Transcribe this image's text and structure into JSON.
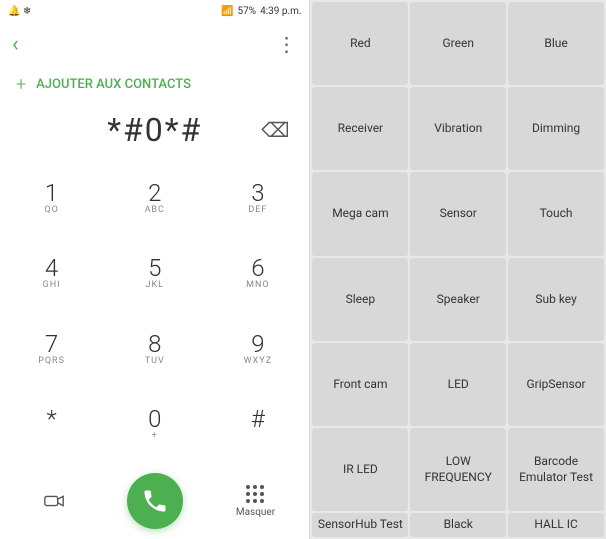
{
  "statusBar": {
    "left": "🔔 ❄",
    "signal": "📶",
    "battery": "57%",
    "time": "4:39 p.m."
  },
  "topBar": {
    "backLabel": "‹",
    "moreLabel": "⋮"
  },
  "addContact": {
    "icon": "+",
    "label": "AJOUTER AUX CONTACTS"
  },
  "display": {
    "number": "*#0*#",
    "backspaceLabel": "⌫"
  },
  "dialpad": [
    {
      "number": "1",
      "letters": "QO",
      "sub": "▢▢"
    },
    {
      "number": "2",
      "letters": "ABC",
      "sub": ""
    },
    {
      "number": "3",
      "letters": "DEF",
      "sub": ""
    },
    {
      "number": "4",
      "letters": "GHI",
      "sub": ""
    },
    {
      "number": "5",
      "letters": "JKL",
      "sub": ""
    },
    {
      "number": "6",
      "letters": "MNO",
      "sub": ""
    },
    {
      "number": "7",
      "letters": "PQRS",
      "sub": ""
    },
    {
      "number": "8",
      "letters": "TUV",
      "sub": ""
    },
    {
      "number": "9",
      "letters": "WXYZ",
      "sub": ""
    },
    {
      "number": "*",
      "letters": "",
      "sub": ""
    },
    {
      "number": "0",
      "letters": "+",
      "sub": ""
    },
    {
      "number": "#",
      "letters": "",
      "sub": ""
    }
  ],
  "bottomActions": {
    "gridLabel": "Masquer"
  },
  "testGrid": [
    {
      "id": "red",
      "label": "Red"
    },
    {
      "id": "green",
      "label": "Green"
    },
    {
      "id": "blue",
      "label": "Blue"
    },
    {
      "id": "receiver",
      "label": "Receiver"
    },
    {
      "id": "vibration",
      "label": "Vibration"
    },
    {
      "id": "dimming",
      "label": "Dimming"
    },
    {
      "id": "mega-cam",
      "label": "Mega cam"
    },
    {
      "id": "sensor",
      "label": "Sensor"
    },
    {
      "id": "touch",
      "label": "Touch"
    },
    {
      "id": "sleep",
      "label": "Sleep"
    },
    {
      "id": "speaker",
      "label": "Speaker"
    },
    {
      "id": "sub-key",
      "label": "Sub key"
    },
    {
      "id": "front-cam",
      "label": "Front cam"
    },
    {
      "id": "led",
      "label": "LED"
    },
    {
      "id": "grip-sensor",
      "label": "GripSensor"
    },
    {
      "id": "ir-led",
      "label": "IR LED"
    },
    {
      "id": "low-frequency",
      "label": "LOW FREQUENCY"
    },
    {
      "id": "barcode-emulator",
      "label": "Barcode Emulator Test"
    },
    {
      "id": "sensor-hub",
      "label": "SensorHub Test"
    },
    {
      "id": "black",
      "label": "Black"
    },
    {
      "id": "hall-ic",
      "label": "HALL IC"
    }
  ]
}
